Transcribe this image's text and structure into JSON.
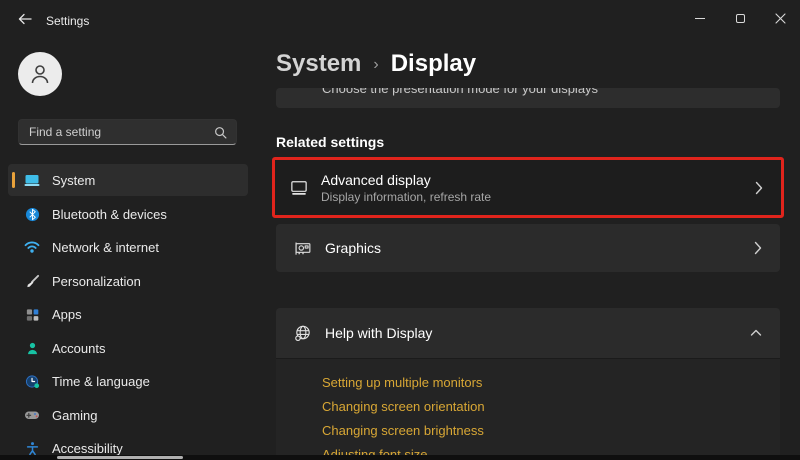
{
  "titlebar": {
    "title": "Settings"
  },
  "sidebar": {
    "search_placeholder": "Find a setting",
    "items": [
      {
        "label": "System",
        "icon": "system-icon",
        "selected": true
      },
      {
        "label": "Bluetooth & devices",
        "icon": "bluetooth-icon",
        "selected": false
      },
      {
        "label": "Network & internet",
        "icon": "network-icon",
        "selected": false
      },
      {
        "label": "Personalization",
        "icon": "personalization-icon",
        "selected": false
      },
      {
        "label": "Apps",
        "icon": "apps-icon",
        "selected": false
      },
      {
        "label": "Accounts",
        "icon": "accounts-icon",
        "selected": false
      },
      {
        "label": "Time & language",
        "icon": "time-language-icon",
        "selected": false
      },
      {
        "label": "Gaming",
        "icon": "gaming-icon",
        "selected": false
      },
      {
        "label": "Accessibility",
        "icon": "accessibility-icon",
        "selected": false
      }
    ]
  },
  "header": {
    "breadcrumb": [
      "System",
      "Display"
    ],
    "separator": "›"
  },
  "main": {
    "clipped_card_text": "Choose the presentation mode for your displays",
    "section_heading": "Related settings",
    "advanced_display": {
      "title": "Advanced display",
      "subtitle": "Display information, refresh rate",
      "highlighted": true
    },
    "graphics": {
      "title": "Graphics"
    },
    "help": {
      "title": "Help with Display",
      "links": [
        "Setting up multiple monitors",
        "Changing screen orientation",
        "Changing screen brightness",
        "Adjusting font size"
      ]
    }
  },
  "colors": {
    "accent_red": "#e0241c",
    "link_gold": "#d8a735",
    "sidebar_accent": "#e9a23b",
    "card_bg": "#2b2b2b",
    "card_pressed_bg": "#1d1d1d",
    "window_bg": "#202020"
  }
}
